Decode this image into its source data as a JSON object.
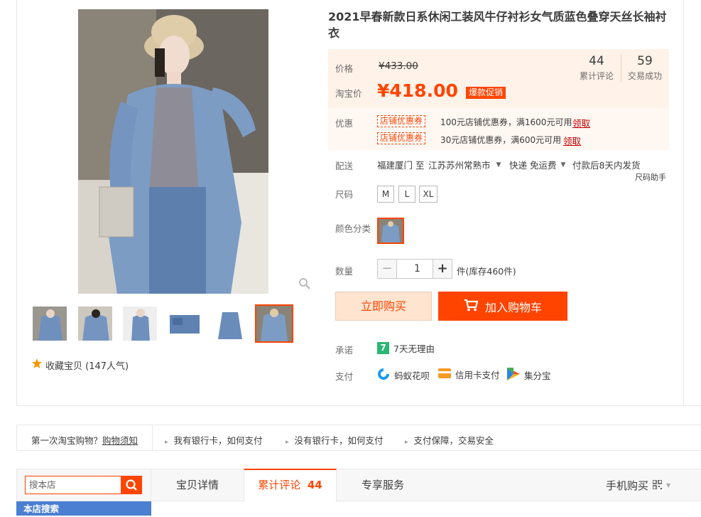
{
  "product": {
    "title": "2021早春新款日系休闲工装风牛仔衬衫女气质蓝色叠穿天丝长袖衬衣",
    "price_label": "价格",
    "original_price": "¥433.00",
    "taobao_price_label": "淘宝价",
    "taobao_price": "¥418.00",
    "hot_badge": "爆款促销",
    "reviews_count": "44",
    "reviews_label": "累计评论",
    "deals_count": "59",
    "deals_label": "交易成功"
  },
  "promo": {
    "label": "优惠",
    "coupons": [
      {
        "tag": "店铺优惠券",
        "text": "100元店铺优惠券，满1600元可用",
        "action": "领取"
      },
      {
        "tag": "店铺优惠券",
        "text": "30元店铺优惠券，满600元可用",
        "action": "领取"
      }
    ]
  },
  "shipping": {
    "label": "配送",
    "from": "福建厦门 至",
    "to": "江苏苏州常熟市",
    "method": "快递 免运费",
    "promise": "付款后8天内发货",
    "size_helper": "尺码助手"
  },
  "size": {
    "label": "尺码",
    "options": [
      "M",
      "L",
      "XL"
    ]
  },
  "color": {
    "label": "颜色分类"
  },
  "quantity": {
    "label": "数量",
    "value": "1",
    "minus": "−",
    "plus": "+",
    "stock": "件(库存460件)"
  },
  "actions": {
    "buy_now": "立即购买",
    "add_cart": "加入购物车"
  },
  "promise": {
    "label": "承诺",
    "badge": "7",
    "text": "7天无理由"
  },
  "payment": {
    "label": "支付",
    "methods": [
      "蚂蚁花呗",
      "信用卡支付",
      "集分宝"
    ]
  },
  "favorite": {
    "text": "收藏宝贝 (147人气)"
  },
  "help_bar": {
    "first": "第一次淘宝购物？",
    "first_link": "购物须知",
    "items": [
      "我有银行卡，如何支付",
      "没有银行卡，如何支付",
      "支付保障，交易安全"
    ]
  },
  "shop": {
    "search_placeholder": "搜本店",
    "search_title": "本店搜索"
  },
  "tabs": {
    "detail": "宝贝详情",
    "reviews": "累计评论",
    "reviews_count": "44",
    "service": "专享服务",
    "mobile": "手机购买"
  },
  "colors": {
    "accent": "#ff4400",
    "price_bg": "#fff2e8"
  }
}
